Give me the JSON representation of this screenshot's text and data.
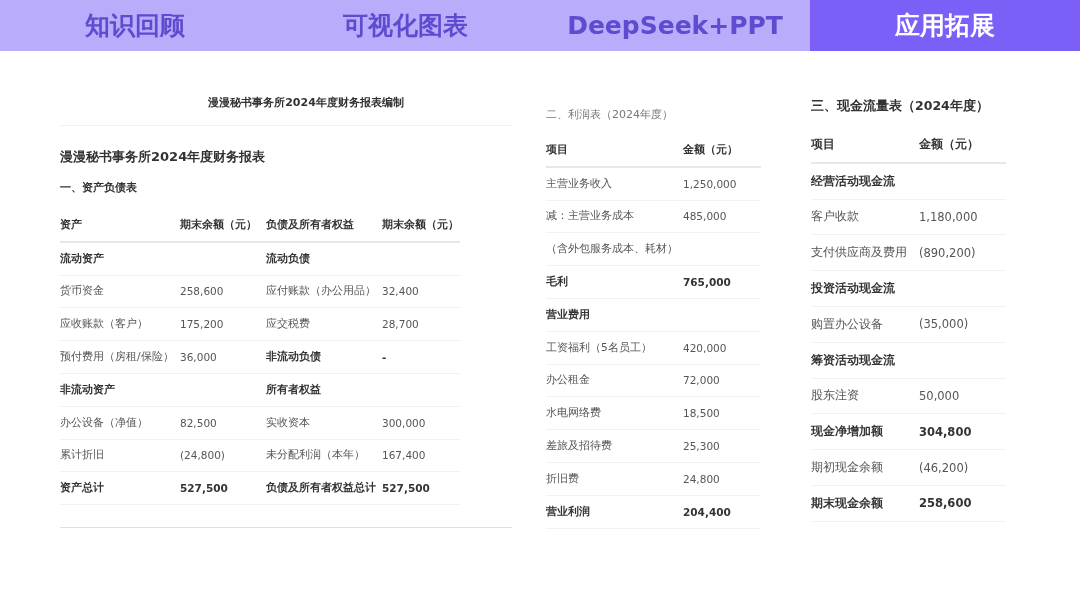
{
  "tabs": [
    {
      "label": "知识回顾",
      "selected": false
    },
    {
      "label": "可视化图表",
      "selected": false
    },
    {
      "label": "DeepSeek+PPT",
      "selected": false
    },
    {
      "label": "应用拓展",
      "selected": true
    }
  ],
  "document": {
    "title": "漫漫秘书事务所2024年度财务报表编制",
    "heading": "漫漫秘书事务所2024年度财务报表",
    "balance_sheet": {
      "title": "一、资产负债表",
      "columns": [
        "资产",
        "期末余额（元）",
        "负债及所有者权益",
        "期末余额（元）"
      ],
      "rows": [
        {
          "left": {
            "label": "流动资产",
            "bold": true
          },
          "right": {
            "label": "流动负债",
            "bold": true
          }
        },
        {
          "left": {
            "label": "货币资金",
            "amount": "258,600",
            "bold": false
          },
          "right": {
            "label": "应付账款（办公用品）",
            "amount": "32,400",
            "bold": false
          }
        },
        {
          "left": {
            "label": "应收账款（客户）",
            "amount": "175,200",
            "bold": false
          },
          "right": {
            "label": "应交税费",
            "amount": "28,700",
            "bold": false
          }
        },
        {
          "left": {
            "label": "预付费用（房租/保险）",
            "amount": "36,000",
            "bold": false
          },
          "right": {
            "label": "非流动负债",
            "amount": "-",
            "bold": true
          }
        },
        {
          "left": {
            "label": "非流动资产",
            "bold": true
          },
          "right": {
            "label": "所有者权益",
            "bold": true
          }
        },
        {
          "left": {
            "label": "办公设备（净值）",
            "amount": "82,500",
            "bold": false
          },
          "right": {
            "label": "实收资本",
            "amount": "300,000",
            "bold": false
          }
        },
        {
          "left": {
            "label": "累计折旧",
            "amount": "(24,800)",
            "bold": false
          },
          "right": {
            "label": "未分配利润（本年）",
            "amount": "167,400",
            "bold": false
          }
        },
        {
          "left": {
            "label": "资产总计",
            "amount": "527,500",
            "bold": true
          },
          "right": {
            "label": "负债及所有者权益总计",
            "amount": "527,500",
            "bold": true
          }
        }
      ]
    }
  },
  "income_statement": {
    "title": "二、利润表（2024年度）",
    "columns": [
      "项目",
      "金额（元）"
    ],
    "rows": [
      {
        "label": "主营业务收入",
        "amount": "1,250,000",
        "bold": false
      },
      {
        "label": "减：主营业务成本",
        "amount": "485,000",
        "bold": false
      },
      {
        "label": "（含外包服务成本、耗材）",
        "bold": false
      },
      {
        "label": "毛利",
        "amount": "765,000",
        "bold": true
      },
      {
        "label": "营业费用",
        "bold": true
      },
      {
        "label": "工资福利（5名员工）",
        "amount": "420,000",
        "bold": false
      },
      {
        "label": "办公租金",
        "amount": "72,000",
        "bold": false
      },
      {
        "label": "水电网络费",
        "amount": "18,500",
        "bold": false
      },
      {
        "label": "差旅及招待费",
        "amount": "25,300",
        "bold": false
      },
      {
        "label": "折旧费",
        "amount": "24,800",
        "bold": false
      },
      {
        "label": "营业利润",
        "amount": "204,400",
        "bold": true
      }
    ]
  },
  "cash_flow": {
    "title": "三、现金流量表（2024年度）",
    "columns": [
      "项目",
      "金额（元）"
    ],
    "rows": [
      {
        "label": "经营活动现金流",
        "bold": true
      },
      {
        "label": "客户收款",
        "amount": "1,180,000",
        "bold": false
      },
      {
        "label": "支付供应商及费用",
        "amount": "(890,200)",
        "bold": false
      },
      {
        "label": "投资活动现金流",
        "bold": true
      },
      {
        "label": "购置办公设备",
        "amount": "(35,000)",
        "bold": false
      },
      {
        "label": "筹资活动现金流",
        "bold": true
      },
      {
        "label": "股东注资",
        "amount": "50,000",
        "bold": false
      },
      {
        "label": "现金净增加额",
        "amount": "304,800",
        "bold": true
      },
      {
        "label": "期初现金余额",
        "amount": "(46,200)",
        "bold": false
      },
      {
        "label": "期末现金余额",
        "amount": "258,600",
        "bold": true
      }
    ]
  }
}
